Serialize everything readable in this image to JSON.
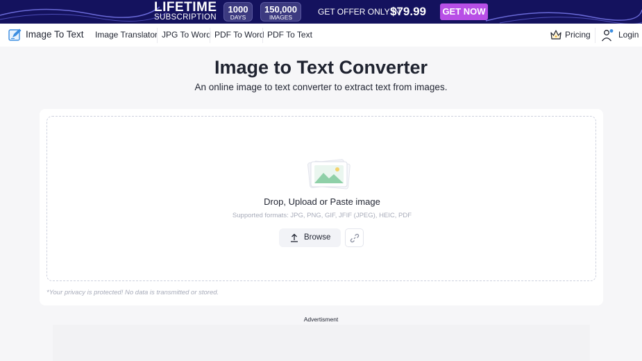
{
  "promo": {
    "title": "LIFETIME",
    "subtitle": "SUBSCRIPTION",
    "pills": [
      {
        "num": "1000",
        "unit": "DAYS"
      },
      {
        "num": "150,000",
        "unit": "IMAGES"
      }
    ],
    "offer_text": "GET OFFER ONLY IN",
    "price": "$79.99",
    "cta": "GET NOW",
    "colors": {
      "background": "#14125e",
      "cta": "#b84fe6"
    }
  },
  "nav": {
    "logo_text": "Image To Text",
    "items": [
      "Image Translator",
      "JPG To Word",
      "PDF To Word",
      "PDF To Text"
    ],
    "pricing": "Pricing",
    "login": "Login"
  },
  "hero": {
    "title": "Image to Text Converter",
    "subtitle": "An online image to text converter to extract text from images."
  },
  "upload": {
    "title": "Drop, Upload or Paste image",
    "formats": "Supported formats: JPG, PNG, GIF, JFIF (JPEG), HEIC, PDF",
    "browse": "Browse",
    "privacy": "*Your privacy is protected! No data is transmitted or stored."
  },
  "ad": {
    "label": "Advertisment"
  }
}
